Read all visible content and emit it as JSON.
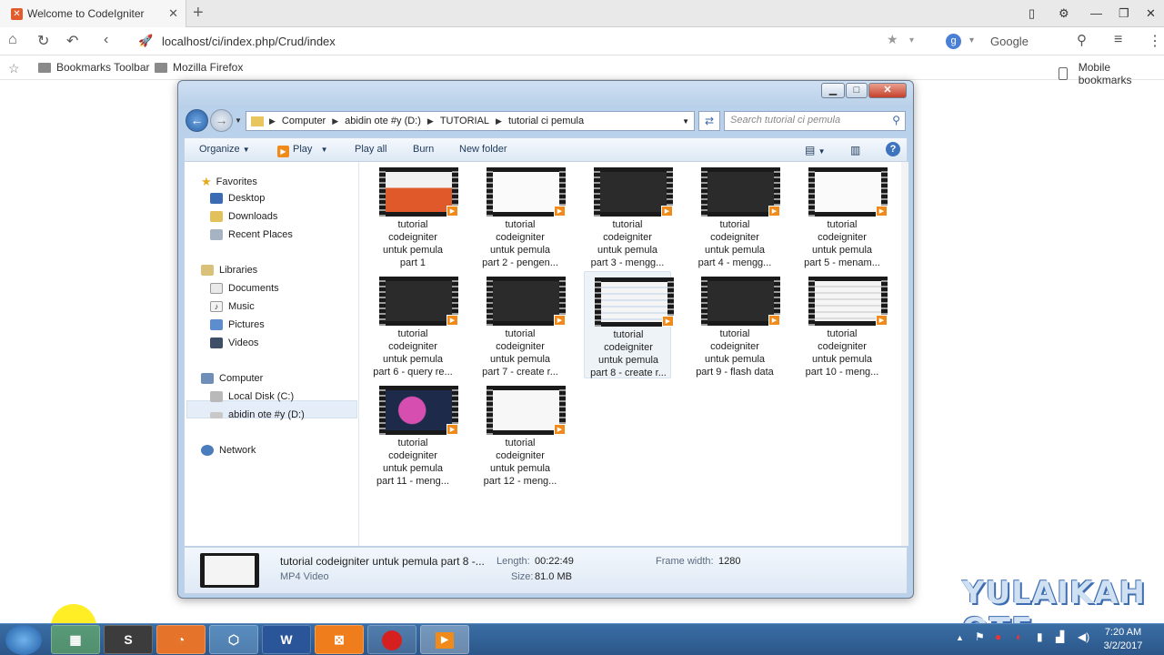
{
  "browser": {
    "tab_title": "Welcome to CodeIgniter",
    "url": "localhost/ci/index.php/Crud/index",
    "search_engine": "Google",
    "bookmarks": [
      "Bookmarks Toolbar",
      "Mozilla Firefox"
    ],
    "mobile_bookmarks": "Mobile bookmarks"
  },
  "explorer": {
    "breadcrumb": [
      "Computer",
      "abidin ote #y (D:)",
      "TUTORIAL",
      "tutorial ci pemula"
    ],
    "search_placeholder": "Search tutorial ci pemula",
    "commands": {
      "organize": "Organize",
      "play": "Play",
      "play_all": "Play all",
      "burn": "Burn",
      "new_folder": "New folder"
    },
    "nav": {
      "favorites": "Favorites",
      "desktop": "Desktop",
      "downloads": "Downloads",
      "recent_places": "Recent Places",
      "libraries": "Libraries",
      "documents": "Documents",
      "music": "Music",
      "pictures": "Pictures",
      "videos": "Videos",
      "computer": "Computer",
      "local_disk": "Local Disk (C:)",
      "drive_d": "abidin ote #y (D:)",
      "network": "Network"
    },
    "files": [
      {
        "line1": "tutorial",
        "line2": "codeigniter",
        "line3": "untuk pemula",
        "line4": "part 1"
      },
      {
        "line1": "tutorial",
        "line2": "codeigniter",
        "line3": "untuk pemula",
        "line4": "part 2 - pengen..."
      },
      {
        "line1": "tutorial",
        "line2": "codeigniter",
        "line3": "untuk pemula",
        "line4": "part 3 -  mengg..."
      },
      {
        "line1": "tutorial",
        "line2": "codeigniter",
        "line3": "untuk pemula",
        "line4": "part 4 - mengg..."
      },
      {
        "line1": "tutorial",
        "line2": "codeigniter",
        "line3": "untuk pemula",
        "line4": "part 5 - menam..."
      },
      {
        "line1": "tutorial",
        "line2": "codeigniter",
        "line3": "untuk pemula",
        "line4": "part 6 - query re..."
      },
      {
        "line1": "tutorial",
        "line2": "codeigniter",
        "line3": "untuk pemula",
        "line4": "part 7 - create r..."
      },
      {
        "line1": "tutorial",
        "line2": "codeigniter",
        "line3": "untuk pemula",
        "line4": "part 8 - create r..."
      },
      {
        "line1": "tutorial",
        "line2": "codeigniter",
        "line3": "untuk pemula",
        "line4": "part 9 - flash data"
      },
      {
        "line1": "tutorial",
        "line2": "codeigniter",
        "line3": "untuk pemula",
        "line4": "part 10 - meng..."
      },
      {
        "line1": "tutorial",
        "line2": "codeigniter",
        "line3": "untuk pemula",
        "line4": "part 11 - meng..."
      },
      {
        "line1": "tutorial",
        "line2": "codeigniter",
        "line3": "untuk pemula",
        "line4": "part 12 - meng..."
      }
    ],
    "details": {
      "name": "tutorial codeigniter untuk pemula part 8 -...",
      "type": "MP4 Video",
      "length_label": "Length:",
      "length_value": "00:22:49",
      "size_label": "Size:",
      "size_value": "81.0 MB",
      "frame_width_label": "Frame width:",
      "frame_width_value": "1280"
    }
  },
  "watermark": "YULAIKAH OTE",
  "taskbar": {
    "time": "7:20 AM",
    "date": "3/2/2017",
    "apps": [
      "S",
      "W",
      "⊠"
    ]
  },
  "colors": {
    "accent_blue": "#3f74bd",
    "video_badge": "#f08a1a",
    "taskbar": "#2b5689"
  }
}
